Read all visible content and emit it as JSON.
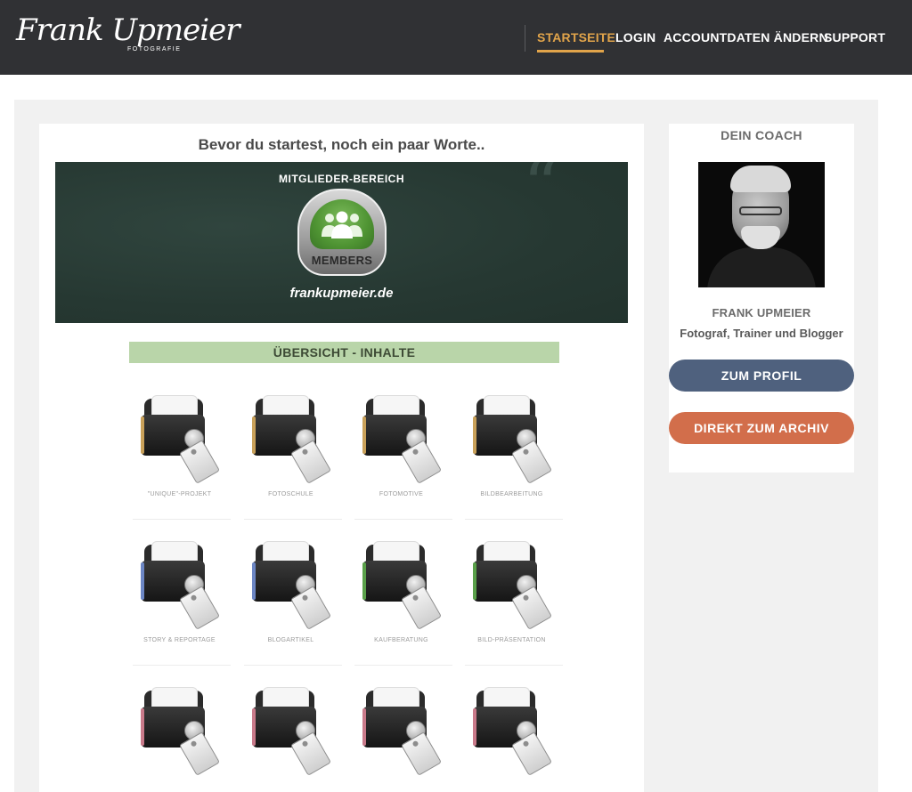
{
  "header": {
    "logo_script": "Frank Upmeier",
    "logo_sub": "FOTOGRAFIE",
    "nav": [
      {
        "label": "STARTSEITE",
        "active": true
      },
      {
        "label": "LOGIN",
        "active": false
      },
      {
        "label": "ACCOUNTDATEN ÄNDERN",
        "active": false
      },
      {
        "label": "SUPPORT",
        "active": false
      }
    ],
    "accent_color": "#e1a44a",
    "background_color": "#303134"
  },
  "main": {
    "title": "Bevor du startest, noch ein paar Worte..",
    "banner": {
      "heading": "MITGLIEDER-BEREICH",
      "badge_label": "MEMBERS",
      "domain": "frankupmeier.de"
    },
    "overview_title": "ÜBERSICHT - INHALTE",
    "tiles": [
      {
        "label": "\"UNIQUE\"-PROJEKT",
        "color": "#c9a15a",
        "icon": "folder-lock-icon"
      },
      {
        "label": "FOTOSCHULE",
        "color": "#c9a15a",
        "icon": "folder-lock-icon"
      },
      {
        "label": "FOTOMOTIVE",
        "color": "#c9a15a",
        "icon": "folder-lock-icon"
      },
      {
        "label": "BILDBEARBEITUNG",
        "color": "#c9a15a",
        "icon": "folder-lock-icon"
      },
      {
        "label": "STORY & REPORTAGE",
        "color": "#6c86c4",
        "icon": "folder-lock-icon"
      },
      {
        "label": "BLOGARTIKEL",
        "color": "#6c86c4",
        "icon": "folder-lock-icon"
      },
      {
        "label": "KAUFBERATUNG",
        "color": "#5aa04a",
        "icon": "folder-lock-icon"
      },
      {
        "label": "BILD-PRÄSENTATION",
        "color": "#5aa04a",
        "icon": "folder-lock-icon"
      },
      {
        "label": "",
        "color": "#c97a8a",
        "icon": "folder-lock-icon"
      },
      {
        "label": "",
        "color": "#c97a8a",
        "icon": "folder-lock-icon"
      },
      {
        "label": "",
        "color": "#c97a8a",
        "icon": "folder-lock-icon"
      },
      {
        "label": "",
        "color": "#c97a8a",
        "icon": "folder-lock-icon"
      }
    ]
  },
  "sidebar": {
    "title": "DEIN COACH",
    "name": "FRANK UPMEIER",
    "description": "Fotograf, Trainer und Blogger",
    "profile_button": "ZUM PROFIL",
    "archive_button": "DIREKT ZUM ARCHIV",
    "profile_button_color": "#4f617e",
    "archive_button_color": "#d26e4b"
  }
}
